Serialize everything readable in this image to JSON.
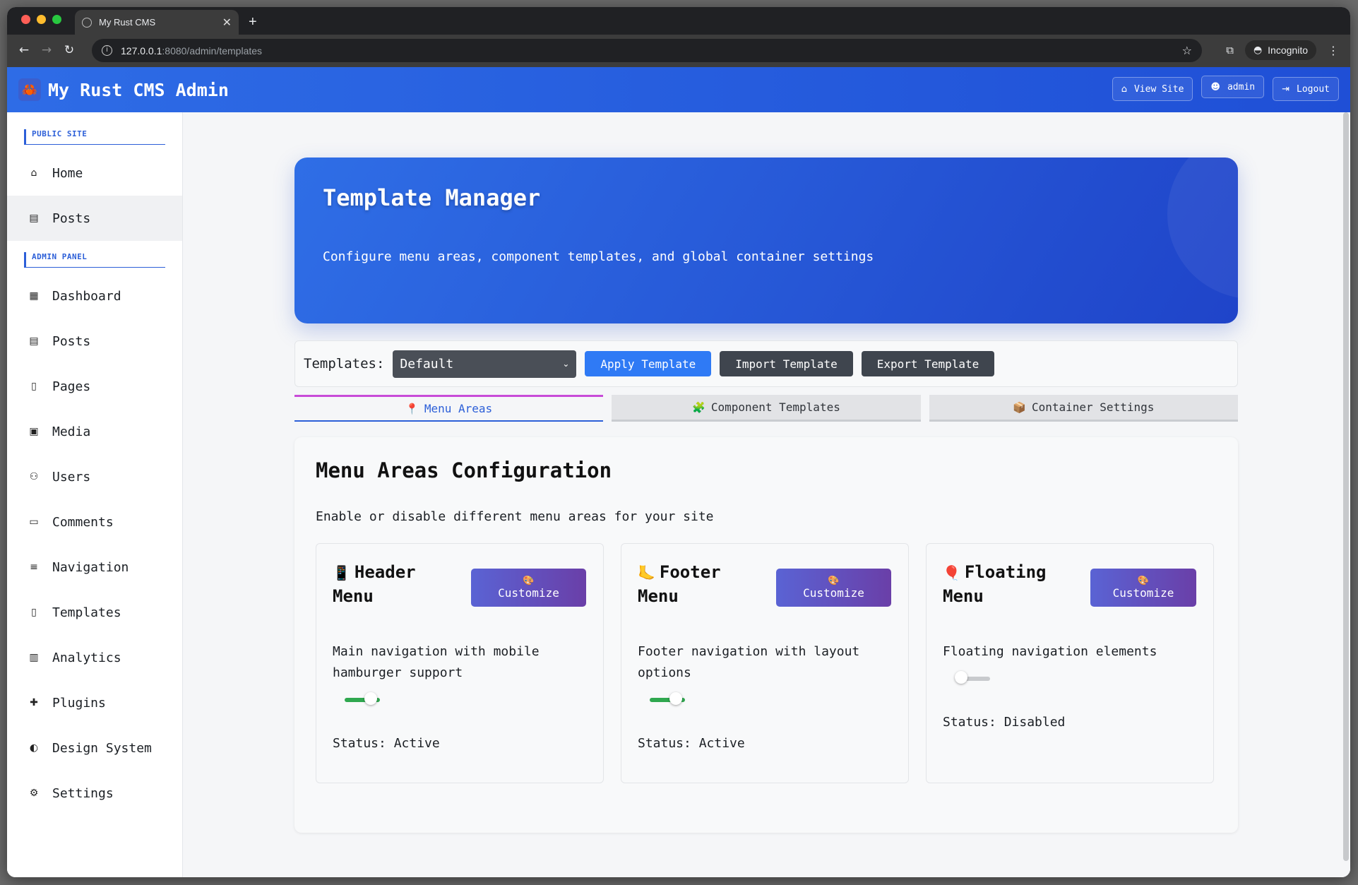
{
  "browser": {
    "tab_title": "My Rust CMS",
    "url_host": "127.0.0.1",
    "url_path": ":8080/admin/templates",
    "incognito_label": "Incognito"
  },
  "topbar": {
    "brand_icon": "🦀",
    "brand_title": "My Rust CMS Admin",
    "view_site": "View Site",
    "user": "admin",
    "logout": "Logout"
  },
  "sidebar": {
    "public_section": "PUBLIC SITE",
    "public_items": [
      {
        "icon": "⌂",
        "label": "Home"
      },
      {
        "icon": "▤",
        "label": "Posts"
      }
    ],
    "admin_section": "ADMIN PANEL",
    "admin_items": [
      {
        "icon": "▦",
        "label": "Dashboard"
      },
      {
        "icon": "▤",
        "label": "Posts"
      },
      {
        "icon": "▯",
        "label": "Pages"
      },
      {
        "icon": "▣",
        "label": "Media"
      },
      {
        "icon": "⚇",
        "label": "Users"
      },
      {
        "icon": "▭",
        "label": "Comments"
      },
      {
        "icon": "≡",
        "label": "Navigation"
      },
      {
        "icon": "▯",
        "label": "Templates"
      },
      {
        "icon": "▥",
        "label": "Analytics"
      },
      {
        "icon": "✚",
        "label": "Plugins"
      },
      {
        "icon": "◐",
        "label": "Design System"
      },
      {
        "icon": "⚙",
        "label": "Settings"
      }
    ]
  },
  "hero": {
    "title": "Template Manager",
    "subtitle": "Configure menu areas, component templates, and global container settings"
  },
  "template_bar": {
    "label": "Templates:",
    "selected": "Default",
    "apply": "Apply Template",
    "import": "Import Template",
    "export": "Export Template"
  },
  "tabs": [
    {
      "emoji": "📍",
      "label": "Menu Areas"
    },
    {
      "emoji": "🧩",
      "label": "Component Templates"
    },
    {
      "emoji": "📦",
      "label": "Container Settings"
    }
  ],
  "panel": {
    "title": "Menu Areas Configuration",
    "subtitle": "Enable or disable different menu areas for your site",
    "customize_emoji": "🎨",
    "customize_label": "Customize",
    "cards": [
      {
        "emoji": "📱",
        "title": "Header Menu",
        "description": "Main navigation with mobile hamburger support",
        "status": "Status: Active",
        "enabled": true
      },
      {
        "emoji": "🦶",
        "title": "Footer Menu",
        "description": "Footer navigation with layout options",
        "status": "Status: Active",
        "enabled": true
      },
      {
        "emoji": "🎈",
        "title": "Floating Menu",
        "description": "Floating navigation elements",
        "status": "Status: Disabled",
        "enabled": false
      }
    ]
  },
  "colors": {
    "primary": "#2f7af5",
    "header_gradient_start": "#2e6ce6",
    "header_gradient_end": "#1f4fd6",
    "toggle_on": "#2fa84f",
    "customize_gradient_start": "#5a63d4",
    "customize_gradient_end": "#6a3fa8"
  }
}
